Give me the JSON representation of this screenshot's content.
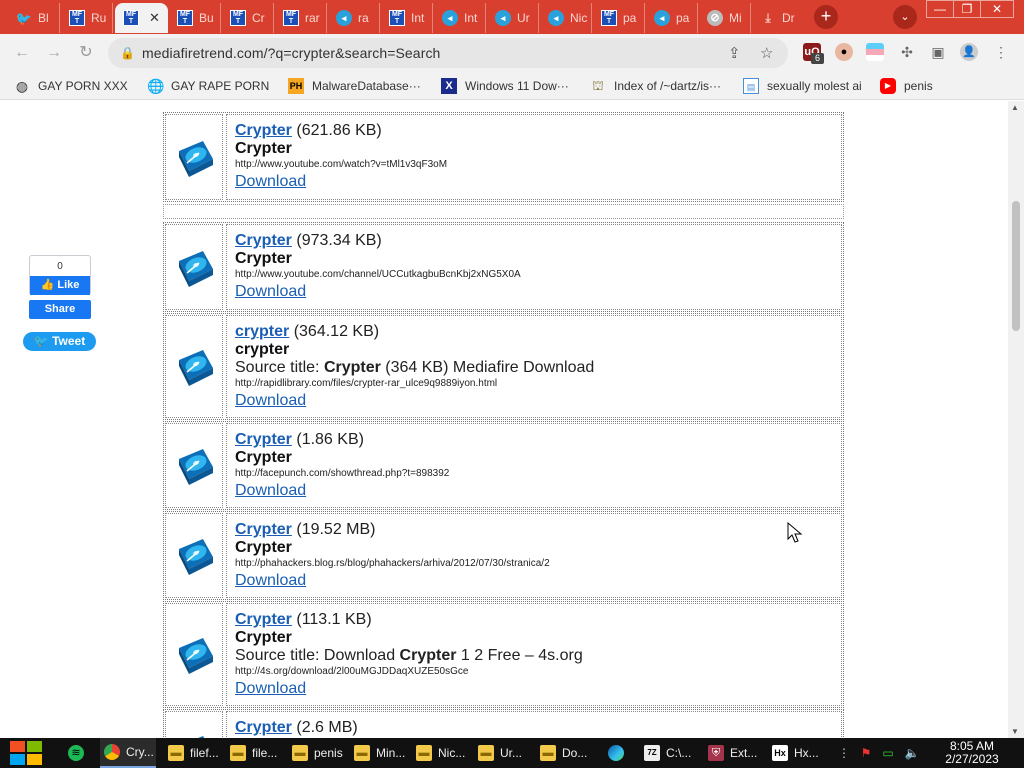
{
  "tabs": [
    {
      "label": "Bl",
      "favicon": "twitter-icon"
    },
    {
      "label": "Ru",
      "favicon": "mft-icon"
    },
    {
      "label": "",
      "favicon": "mft-icon",
      "active": true
    },
    {
      "label": "Bu",
      "favicon": "mft-icon"
    },
    {
      "label": "Cr",
      "favicon": "mft-icon"
    },
    {
      "label": "rar",
      "favicon": "mft-icon"
    },
    {
      "label": "ra",
      "favicon": "telegram-icon"
    },
    {
      "label": "Int",
      "favicon": "mft-icon"
    },
    {
      "label": "Int",
      "favicon": "telegram-icon"
    },
    {
      "label": "Ur",
      "favicon": "telegram-icon"
    },
    {
      "label": "Nic",
      "favicon": "telegram-icon"
    },
    {
      "label": "pa",
      "favicon": "mft-icon"
    },
    {
      "label": "pa",
      "favicon": "telegram-icon"
    },
    {
      "label": "Mi",
      "favicon": "blocked-icon"
    },
    {
      "label": "Dr",
      "favicon": "download-icon"
    }
  ],
  "tab_close_glyph": "✕",
  "favicon_text": {
    "mft": "MF T"
  },
  "window": {
    "minimize": "—",
    "restore": "❐",
    "close": "✕"
  },
  "newtab_glyph": "+",
  "tabsearch_glyph": "⌄",
  "address_bar": {
    "url": "mediafiretrend.com/?q=crypter&search=Search"
  },
  "extensions": {
    "ublock_badge": "6"
  },
  "bookmarks": [
    {
      "label": "GAY PORN XXX",
      "icon": "github-icon"
    },
    {
      "label": "GAY RAPE PORN",
      "icon": "globe-icon"
    },
    {
      "label": "MalwareDatabase···",
      "icon": "ph-icon",
      "icon_text": "PH"
    },
    {
      "label": "Windows 11 Dow···",
      "icon": "x-icon",
      "icon_text": "X"
    },
    {
      "label": "Index of /~dartz/is···",
      "icon": "folder-icon"
    },
    {
      "label": "sexually molest ai",
      "icon": "image-icon"
    },
    {
      "label": "penis",
      "icon": "youtube-icon"
    }
  ],
  "social": {
    "like_count": "0",
    "like_label": "Like",
    "share_label": "Share",
    "tweet_label": "Tweet"
  },
  "results": [
    {
      "title": "Crypter",
      "size": "(621.86 KB)",
      "name": "Crypter",
      "source": null,
      "url": "http://www.youtube.com/watch?v=tMl1v3qF3oM",
      "download": "Download"
    },
    {
      "title": "Crypter",
      "size": "(973.34 KB)",
      "name": "Crypter",
      "source": null,
      "url": "http://www.youtube.com/channel/UCCutkagbuBcnKbj2xNG5X0A",
      "download": "Download"
    },
    {
      "title": "crypter",
      "size": "(364.12 KB)",
      "name": "crypter",
      "source": {
        "prefix": "Source title: ",
        "bold": "Crypter",
        "suffix": " (364 KB) Mediafire Download"
      },
      "url": "http://rapidlibrary.com/files/crypter-rar_ulce9q9889iyon.html",
      "download": "Download"
    },
    {
      "title": "Crypter",
      "size": "(1.86 KB)",
      "name": "Crypter",
      "source": null,
      "url": "http://facepunch.com/showthread.php?t=898392",
      "download": "Download"
    },
    {
      "title": "Crypter",
      "size": "(19.52 MB)",
      "name": "Crypter",
      "source": null,
      "url": "http://phahackers.blog.rs/blog/phahackers/arhiva/2012/07/30/stranica/2",
      "download": "Download"
    },
    {
      "title": "Crypter",
      "size": "(113.1 KB)",
      "name": "Crypter",
      "source": {
        "prefix": "Source title: Download ",
        "bold": "Crypter",
        "suffix": " 1 2 Free – 4s.org"
      },
      "url": "http://4s.org/download/2l00uMGJDDaqXUZE50sGce",
      "download": "Download"
    },
    {
      "title": "Crypter",
      "size": "(2.6 MB)",
      "name": "",
      "source": null,
      "url": "",
      "download": ""
    }
  ],
  "taskbar": {
    "items": [
      {
        "label": "",
        "icon": "spotify-icon"
      },
      {
        "label": "Cry...",
        "icon": "chrome-icon",
        "active": true
      },
      {
        "label": "filef...",
        "icon": "folder-icon"
      },
      {
        "label": "file...",
        "icon": "folder-icon"
      },
      {
        "label": "penis",
        "icon": "folder-icon"
      },
      {
        "label": "Min...",
        "icon": "folder-icon"
      },
      {
        "label": "Nic...",
        "icon": "folder-icon"
      },
      {
        "label": "Ur...",
        "icon": "folder-icon"
      },
      {
        "label": "Do...",
        "icon": "folder-icon"
      },
      {
        "label": "",
        "icon": "edge-icon"
      },
      {
        "label": "C:\\...",
        "icon": "7zip-icon",
        "icon_text": "7Z"
      },
      {
        "label": "Ext...",
        "icon": "shield-icon"
      },
      {
        "label": "Hx...",
        "icon": "hxd-icon",
        "icon_text": "Hx"
      }
    ],
    "clock": {
      "time": "8:05 AM",
      "date": "2/27/2023"
    }
  },
  "colors": {
    "accent": "#d93f2f",
    "link": "#1a5fb4",
    "facebook": "#1877f2",
    "twitter": "#1d9bf0",
    "taskbar": "#111111"
  }
}
